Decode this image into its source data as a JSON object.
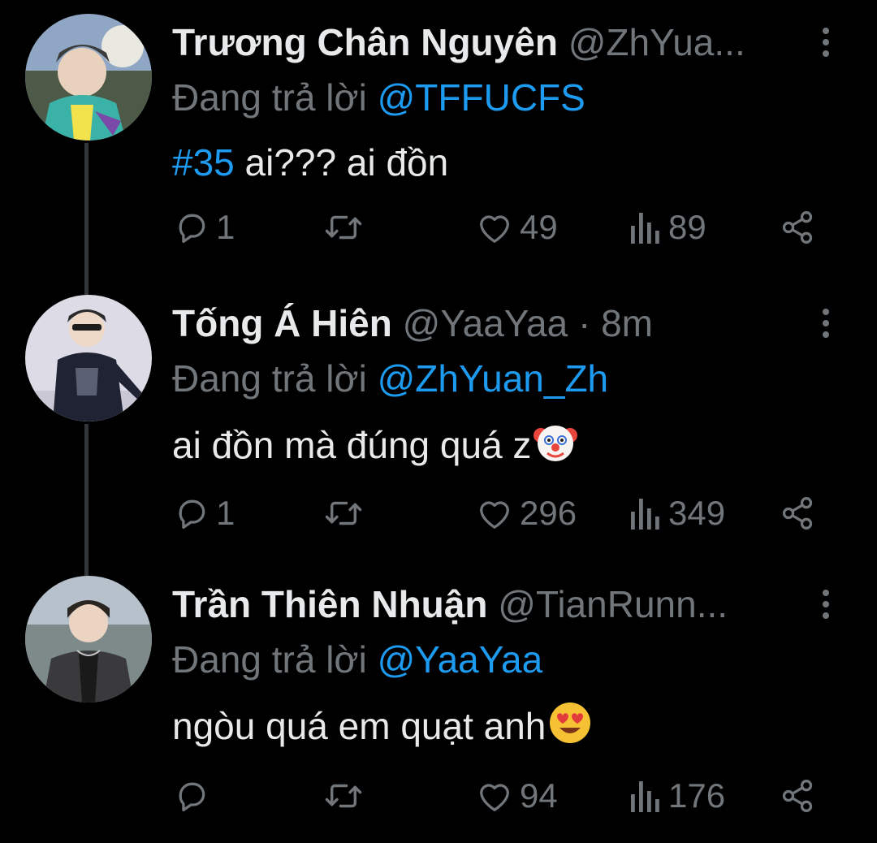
{
  "colors": {
    "background": "#000000",
    "text": "#e7e9ea",
    "muted": "#71767b",
    "accent": "#1d9bf0",
    "thread_line": "#333639"
  },
  "tweets": [
    {
      "name": "Trương Chân Nguyên",
      "handle": "@ZhYua...",
      "reply_prefix": "Đang trả lời ",
      "reply_to": "@TFFUCFS",
      "hashtag": "#35",
      "text": " ai??? ai đồn",
      "emoji": "",
      "replies": "1",
      "retweets": "",
      "likes": "49",
      "views": "89"
    },
    {
      "name": "Tống Á Hiên",
      "handle": "@YaaYaa · 8m",
      "reply_prefix": "Đang trả lời ",
      "reply_to": "@ZhYuan_Zh",
      "hashtag": "",
      "text": "ai đồn mà đúng quá z",
      "emoji": "clown-face",
      "replies": "1",
      "retweets": "",
      "likes": "296",
      "views": "349"
    },
    {
      "name": "Trần Thiên Nhuận",
      "handle": "@TianRunn...",
      "reply_prefix": "Đang trả lời ",
      "reply_to": "@YaaYaa",
      "hashtag": "",
      "text": "ngòu quá em quạt anh",
      "emoji": "heart-eyes-face",
      "replies": "",
      "retweets": "",
      "likes": "94",
      "views": "176"
    }
  ]
}
